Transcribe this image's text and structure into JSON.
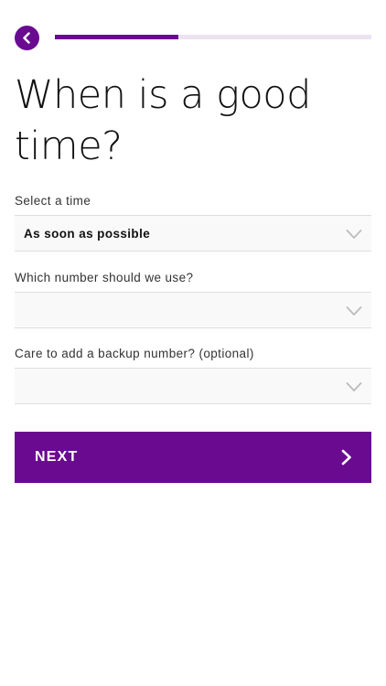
{
  "header": {
    "back_icon": "chevron-left-icon",
    "progress": 0.39
  },
  "title": "When is a good time?",
  "fields": {
    "time": {
      "label": "Select a time",
      "value": "As soon as possible"
    },
    "number": {
      "label": "Which number should we use?",
      "value": ""
    },
    "backup": {
      "label": "Care to add a backup number? (optional)",
      "value": ""
    }
  },
  "next_button": {
    "label": "NEXT",
    "icon": "chevron-right-icon"
  },
  "colors": {
    "accent": "#6a0a91",
    "progress_track": "#ece3f1",
    "field_bg": "#f9f9f9",
    "field_border": "#dedede",
    "chevron": "#bbbbbb"
  }
}
